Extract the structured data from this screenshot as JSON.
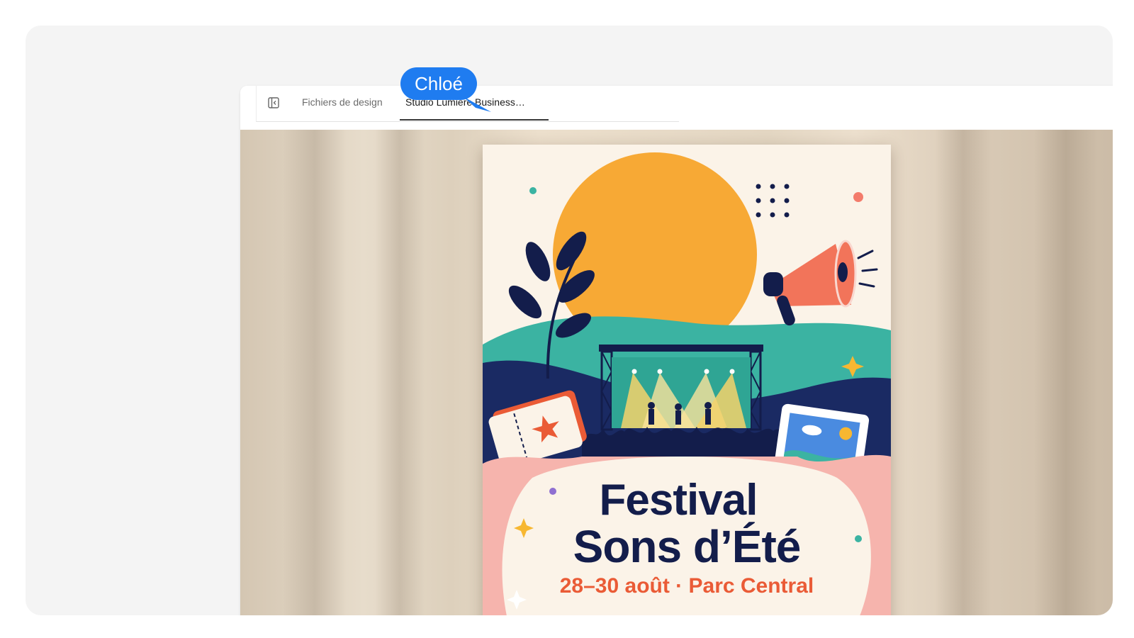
{
  "tabs": {
    "design_files": "Fichiers de design",
    "active_file": "Studio Lumière Business…"
  },
  "collaborator": {
    "name": "Chloé",
    "color": "#1f7cf0"
  },
  "poster": {
    "title_line1": "Festival",
    "title_line2": "Sons d’Été",
    "subtitle": "28–30 août · Parc Central"
  },
  "colors": {
    "navy": "#131d4b",
    "orange_sun": "#f7a935",
    "teal": "#3bb3a2",
    "coral": "#ea5b36",
    "pink": "#f6b4ad"
  }
}
